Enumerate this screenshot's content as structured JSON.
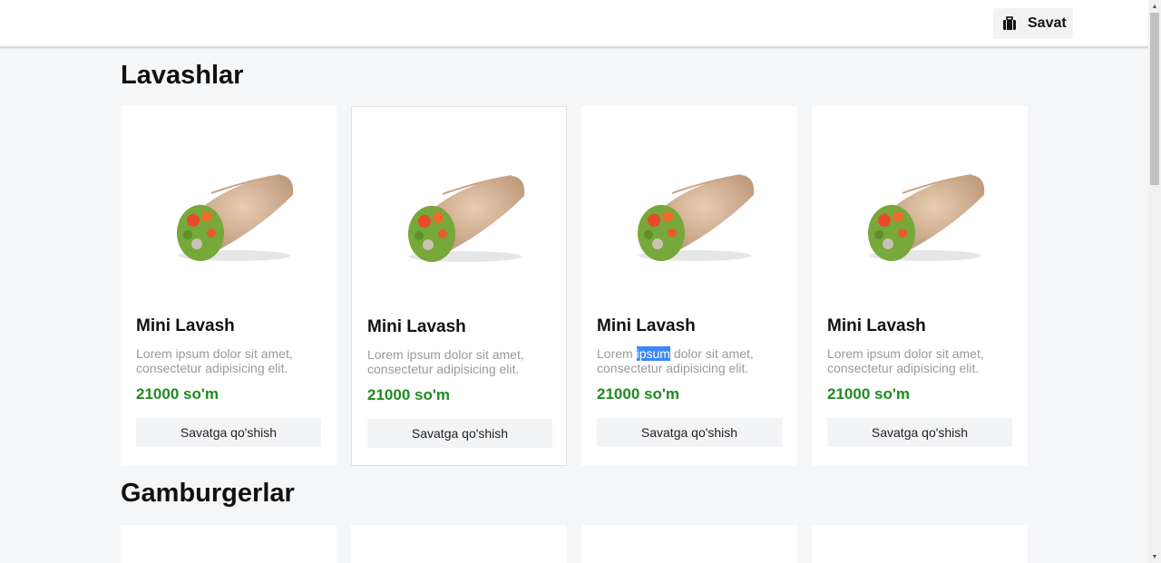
{
  "header": {
    "cart_label": "Savat",
    "cart_icon": "briefcase-icon"
  },
  "sections": [
    {
      "title": "Lavashlar",
      "products": [
        {
          "name": "Mini Lavash",
          "desc_before": "Lorem ipsum dolor sit amet, consectetur adipisicing elit.",
          "desc_selected": "",
          "desc_after": "",
          "price": "21000 so'm",
          "button": "Savatga qo'shish"
        },
        {
          "name": "Mini Lavash",
          "desc_before": "Lorem ipsum dolor sit amet, consectetur adipisicing elit.",
          "desc_selected": "",
          "desc_after": "",
          "price": "21000 so'm",
          "button": "Savatga qo'shish"
        },
        {
          "name": "Mini Lavash",
          "desc_before": "Lorem ",
          "desc_selected": "ipsum",
          "desc_after": " dolor sit amet, consectetur adipisicing elit.",
          "price": "21000 so'm",
          "button": "Savatga qo'shish"
        },
        {
          "name": "Mini Lavash",
          "desc_before": "Lorem ipsum dolor sit amet, consectetur adipisicing elit.",
          "desc_selected": "",
          "desc_after": "",
          "price": "21000 so'm",
          "button": "Savatga qo'shish"
        }
      ]
    },
    {
      "title": "Gamburgerlar",
      "products": []
    }
  ],
  "colors": {
    "price": "#1f8a1f",
    "selection": "#3a87f7",
    "background": "#f5f6f8"
  }
}
